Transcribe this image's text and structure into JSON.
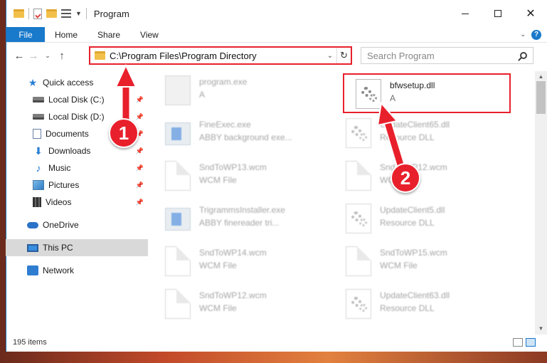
{
  "window": {
    "title": "Program",
    "controls": [
      "minimize-icon",
      "maximize-icon",
      "close-icon"
    ]
  },
  "ribbon": {
    "tabs": [
      "File",
      "Home",
      "Share",
      "View"
    ],
    "help_glyph": "?"
  },
  "address": {
    "path": "C:\\Program Files\\Program Directory",
    "search_placeholder": "Search Program"
  },
  "nav": {
    "items": [
      {
        "label": "Quick access",
        "icon": "star-icon",
        "pinned": false
      },
      {
        "label": "Local Disk (C:)",
        "icon": "disk-icon",
        "pinned": true
      },
      {
        "label": "Local Disk (D:)",
        "icon": "disk-icon",
        "pinned": true
      },
      {
        "label": "Documents",
        "icon": "documents-icon",
        "pinned": true
      },
      {
        "label": "Downloads",
        "icon": "download-icon",
        "pinned": true
      },
      {
        "label": "Music",
        "icon": "music-icon",
        "pinned": true
      },
      {
        "label": "Pictures",
        "icon": "pictures-icon",
        "pinned": true
      },
      {
        "label": "Videos",
        "icon": "videos-icon",
        "pinned": true
      },
      {
        "label": "OneDrive",
        "icon": "cloud-icon",
        "pinned": false
      },
      {
        "label": "This PC",
        "icon": "computer-icon",
        "pinned": false,
        "selected": true
      },
      {
        "label": "Network",
        "icon": "network-icon",
        "pinned": false
      }
    ]
  },
  "files": [
    {
      "name": "program.exe",
      "sub": "A",
      "type": "exe",
      "faded": true
    },
    {
      "name": "bfwsetup.dll",
      "sub": "A",
      "type": "dll",
      "faded": false,
      "highlighted": true
    },
    {
      "name": "FineExec.exe",
      "sub": "ABBY background exe...",
      "type": "app",
      "faded": true
    },
    {
      "name": "UpdateClient65.dll",
      "sub": "Resource DLL",
      "type": "dll",
      "faded": true
    },
    {
      "name": "SndToWP13.wcm",
      "sub": "WCM File",
      "type": "page",
      "faded": true
    },
    {
      "name": "SndToWP12.wcm",
      "sub": "WCM File",
      "type": "page",
      "faded": true
    },
    {
      "name": "TrigrammsInstaller.exe",
      "sub": "ABBY finereader tri...",
      "type": "app",
      "faded": true
    },
    {
      "name": "UpdateClient5.dll",
      "sub": "Resource DLL",
      "type": "dll",
      "faded": true
    },
    {
      "name": "SndToWP14.wcm",
      "sub": "WCM File",
      "type": "page",
      "faded": true
    },
    {
      "name": "SndToWP15.wcm",
      "sub": "WCM File",
      "type": "page",
      "faded": true
    },
    {
      "name": "SndToWP12.wcm",
      "sub": "WCM File",
      "type": "page",
      "faded": true
    },
    {
      "name": "UpdateClient63.dll",
      "sub": "Resource DLL",
      "type": "dll",
      "faded": true
    }
  ],
  "status": {
    "item_count": "195 items"
  },
  "annotations": {
    "step1": "1",
    "step2": "2",
    "color": "#e8202c"
  }
}
